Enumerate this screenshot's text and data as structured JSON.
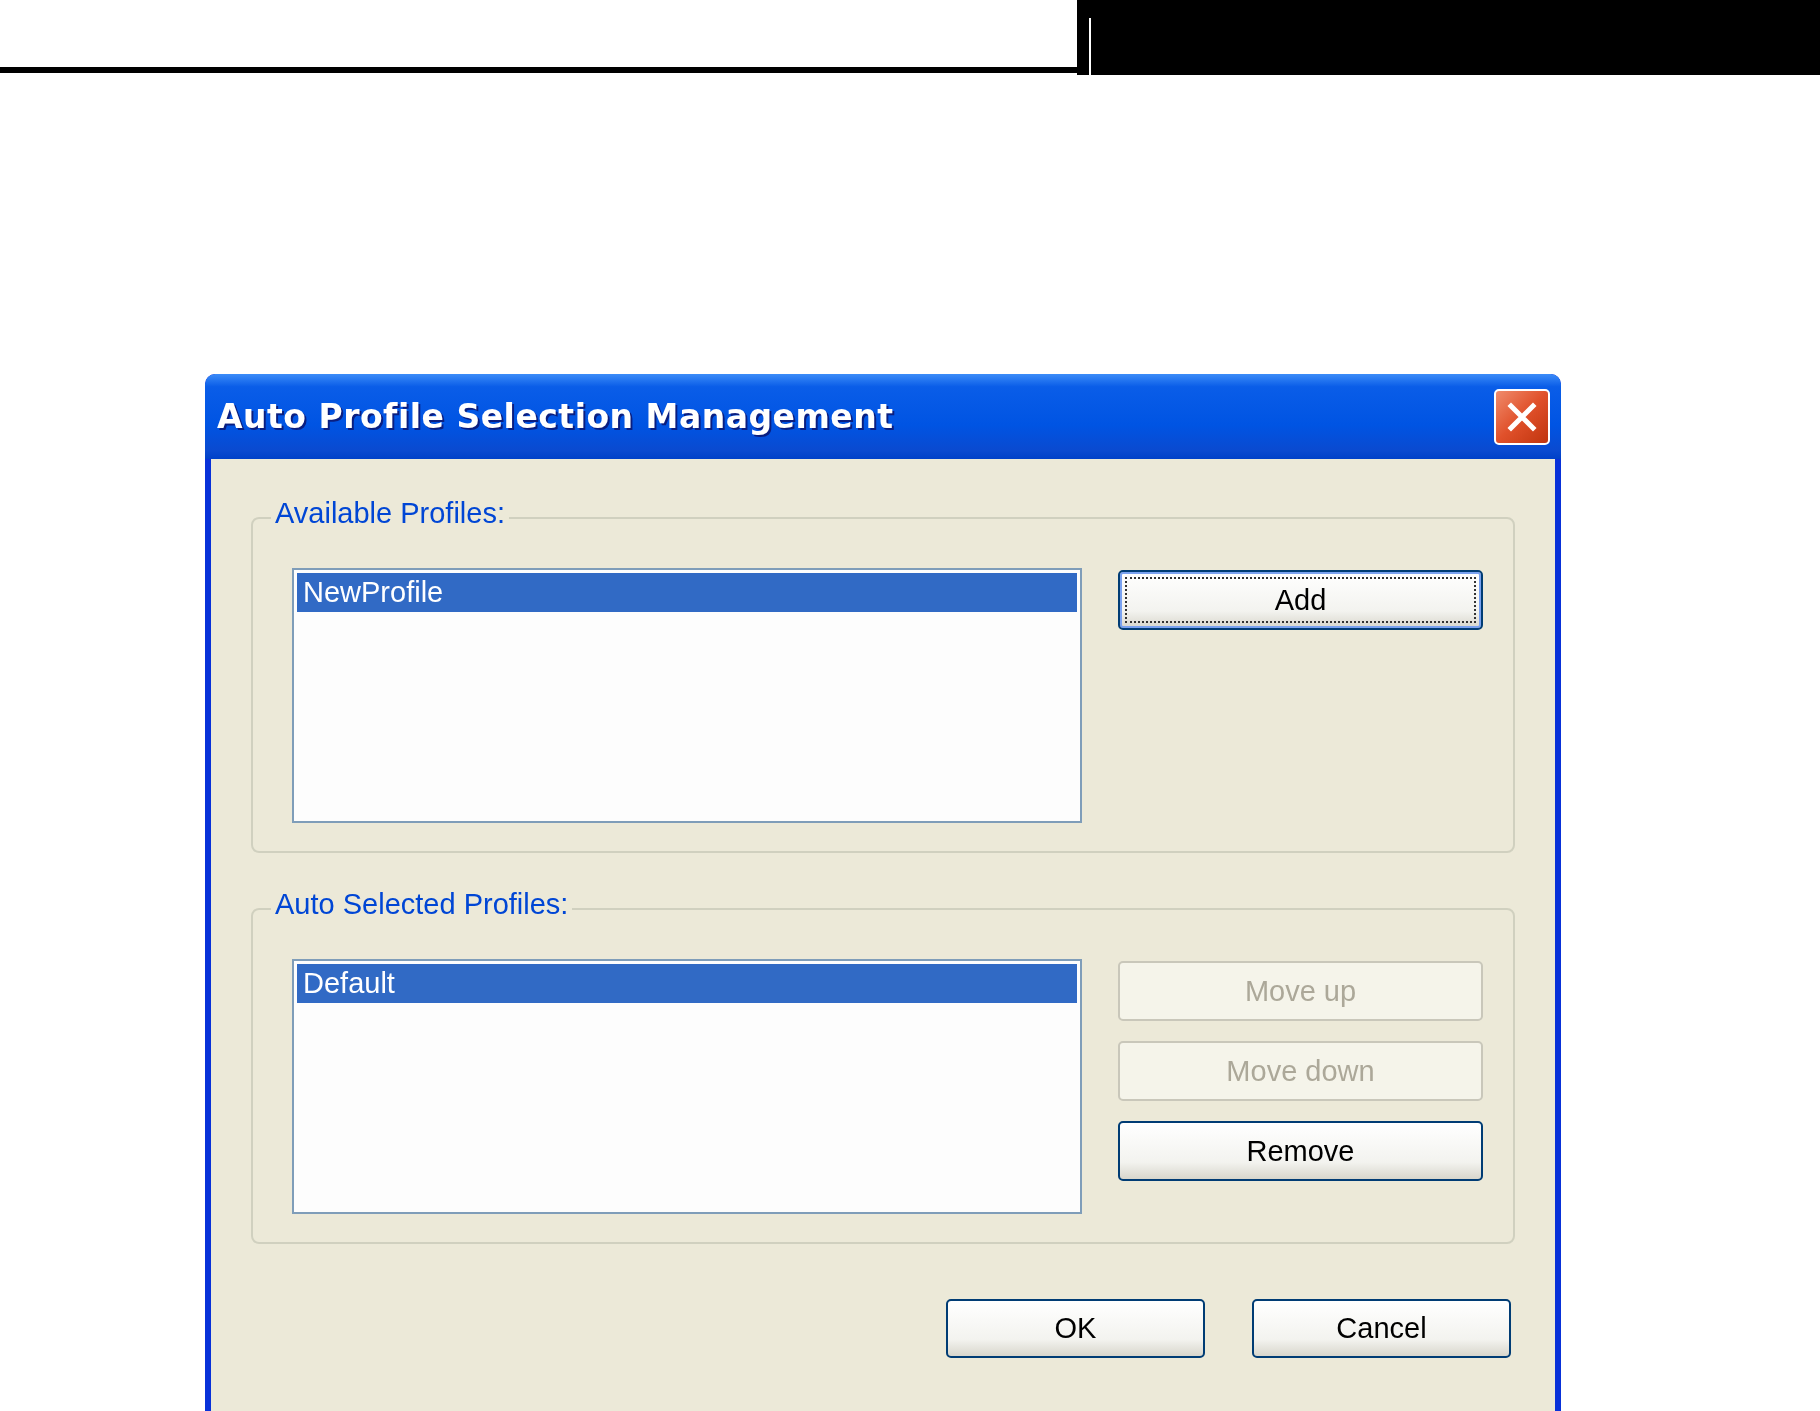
{
  "window": {
    "title": "Auto Profile Selection Management"
  },
  "groups": [
    {
      "title": "Available Profiles:",
      "items": [
        {
          "label": "NewProfile",
          "selected": true
        }
      ],
      "buttons": [
        {
          "label": "Add",
          "disabled": false,
          "focused": true
        }
      ]
    },
    {
      "title": "Auto Selected Profiles:",
      "items": [
        {
          "label": "Default",
          "selected": true
        }
      ],
      "buttons": [
        {
          "label": "Move up",
          "disabled": true,
          "focused": false
        },
        {
          "label": "Move down",
          "disabled": true,
          "focused": false
        },
        {
          "label": "Remove",
          "disabled": false,
          "focused": false
        }
      ]
    }
  ],
  "footer_buttons": [
    {
      "label": "OK",
      "disabled": false,
      "focused": false
    },
    {
      "label": "Cancel",
      "disabled": false,
      "focused": false
    }
  ]
}
